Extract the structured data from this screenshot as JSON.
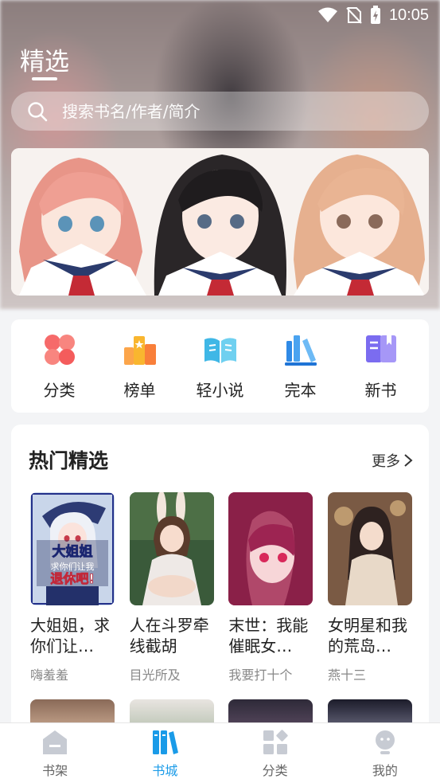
{
  "status": {
    "time": "10:05"
  },
  "header": {
    "title": "精选",
    "search_placeholder": "搜索书名/作者/简介"
  },
  "categories": [
    {
      "label": "分类",
      "icon": "clover-icon"
    },
    {
      "label": "榜单",
      "icon": "ranking-icon"
    },
    {
      "label": "轻小说",
      "icon": "open-book-icon"
    },
    {
      "label": "完本",
      "icon": "books-shelf-icon"
    },
    {
      "label": "新书",
      "icon": "new-book-icon"
    }
  ],
  "hot": {
    "title": "热门精选",
    "more_label": "更多",
    "books": [
      {
        "title": "大姐姐，求你们让…",
        "author": "嗨羞羞",
        "cover_text": "大姐姐 求你们让我 退休吧!"
      },
      {
        "title": "人在斗罗牵线截胡",
        "author": "目光所及"
      },
      {
        "title": "末世：我能催眠女…",
        "author": "我要打十个"
      },
      {
        "title": "女明星和我的荒岛…",
        "author": "燕十三"
      }
    ]
  },
  "tabbar": {
    "items": [
      {
        "label": "书架",
        "active": false
      },
      {
        "label": "书城",
        "active": true
      },
      {
        "label": "分类",
        "active": false
      },
      {
        "label": "我的",
        "active": false
      }
    ]
  },
  "colors": {
    "accent": "#1a9be8"
  }
}
